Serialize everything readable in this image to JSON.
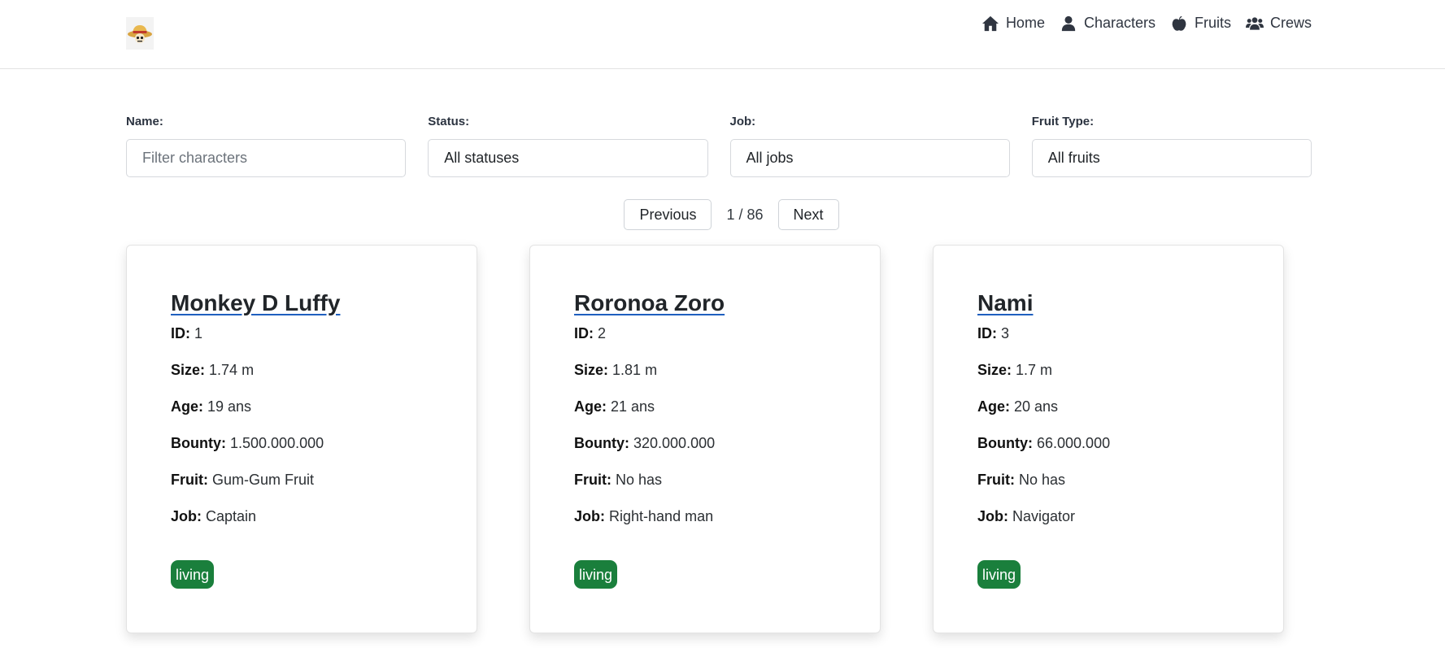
{
  "nav": {
    "logo_icon": "straw-hat-skull-logo",
    "items": [
      {
        "label": "Home",
        "icon": "home-icon"
      },
      {
        "label": "Characters",
        "icon": "person-icon"
      },
      {
        "label": "Fruits",
        "icon": "apple-icon"
      },
      {
        "label": "Crews",
        "icon": "group-icon"
      }
    ]
  },
  "filters": {
    "name_label": "Name:",
    "name_placeholder": "Filter characters",
    "status_label": "Status:",
    "status_value": "All statuses",
    "job_label": "Job:",
    "job_value": "All jobs",
    "fruit_label": "Fruit Type:",
    "fruit_value": "All fruits"
  },
  "pagination": {
    "previous": "Previous",
    "info": "1 / 86",
    "next": "Next"
  },
  "field_labels": {
    "id": "ID:",
    "size": "Size:",
    "age": "Age:",
    "bounty": "Bounty:",
    "fruit": "Fruit:",
    "job": "Job:"
  },
  "colors": {
    "status_living": "#1a7f3c",
    "link_underline": "#1f5fbf"
  },
  "characters": [
    {
      "name": "Monkey D Luffy",
      "id": "1",
      "size": "1.74 m",
      "age": "19 ans",
      "bounty": "1.500.000.000",
      "fruit": "Gum-Gum Fruit",
      "job": "Captain",
      "status": "living"
    },
    {
      "name": "Roronoa Zoro",
      "id": "2",
      "size": "1.81 m",
      "age": "21 ans",
      "bounty": "320.000.000",
      "fruit": "No has",
      "job": "Right-hand man",
      "status": "living"
    },
    {
      "name": "Nami",
      "id": "3",
      "size": "1.7 m",
      "age": "20 ans",
      "bounty": "66.000.000",
      "fruit": "No has",
      "job": "Navigator",
      "status": "living"
    }
  ]
}
